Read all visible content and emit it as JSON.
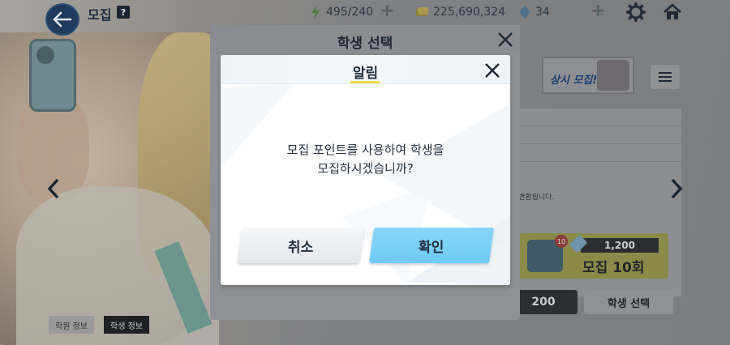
{
  "header": {
    "title": "모집",
    "help_label": "?",
    "ap": "495/240",
    "credits": "225,690,324",
    "gems": "34"
  },
  "back_dialog": {
    "title": "학생 선택"
  },
  "alert": {
    "title": "알림",
    "message_line1": "모집 포인트를 사용하여 학생을",
    "message_line2": "모집하시겠습니까?",
    "cancel_label": "취소",
    "confirm_label": "확인"
  },
  "side": {
    "banner_label": "상시 모집!",
    "partial_text_top": "|",
    "partial_text_desc": "로 변환됩니다.",
    "recruit10_cost": "1,200",
    "recruit10_label": "모집 10회",
    "recruit10_badge": "10",
    "partial_cost": "200",
    "select_student_label": "학생 선택"
  },
  "bottom_tabs": [
    "학원 정보",
    "학생 정보"
  ],
  "colors": {
    "accent_yellow": "#f2dc48",
    "confirm_blue": "#78cff5",
    "cancel_gray": "#eef1f4",
    "back_button_navy": "#1f3a5c"
  },
  "icons": [
    "back-arrow-icon",
    "help-icon",
    "lightning-icon",
    "credit-icon",
    "gem-icon",
    "plus-icon",
    "gear-icon",
    "home-icon",
    "close-icon",
    "chevron-left-icon",
    "chevron-right-icon",
    "menu-icon",
    "envelope-icon"
  ]
}
